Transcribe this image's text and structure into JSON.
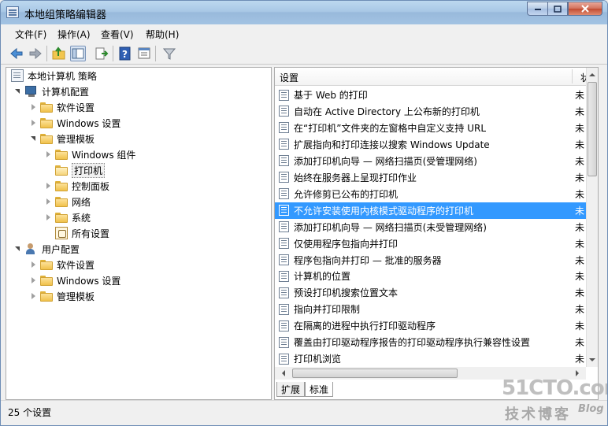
{
  "window": {
    "title": "本地组策略编辑器"
  },
  "menu": [
    "文件(F)",
    "操作(A)",
    "查看(V)",
    "帮助(H)"
  ],
  "toolbar": {
    "icons": [
      "back-icon",
      "forward-icon",
      "up-folder-icon",
      "show-hide-tree-icon",
      "export-list-icon",
      "help-icon",
      "properties-icon",
      "filter-icon"
    ]
  },
  "tree": {
    "root": "本地计算机 策略",
    "computer_config": "计算机配置",
    "cc_software": "软件设置",
    "cc_windows": "Windows 设置",
    "cc_admin": "管理模板",
    "cc_admin_windows_components": "Windows 组件",
    "cc_admin_printers": "打印机",
    "cc_admin_control_panel": "控制面板",
    "cc_admin_network": "网络",
    "cc_admin_system": "系统",
    "cc_admin_all_settings": "所有设置",
    "user_config": "用户配置",
    "uc_software": "软件设置",
    "uc_windows": "Windows 设置",
    "uc_admin": "管理模板"
  },
  "list": {
    "header_setting": "设置",
    "header_state": "状",
    "rows": [
      {
        "text": "基于 Web 的打印",
        "state": "未"
      },
      {
        "text": "自动在 Active Directory 上公布新的打印机",
        "state": "未"
      },
      {
        "text": "在“打印机”文件夹的左窗格中自定义支持 URL",
        "state": "未"
      },
      {
        "text": "扩展指向和打印连接以搜索 Windows Update",
        "state": "未"
      },
      {
        "text": "添加打印机向导 — 网络扫描页(受管理网络)",
        "state": "未"
      },
      {
        "text": "始终在服务器上呈现打印作业",
        "state": "未"
      },
      {
        "text": "允许修剪已公布的打印机",
        "state": "未"
      },
      {
        "text": "不允许安装使用内核模式驱动程序的打印机",
        "state": "未",
        "selected": true
      },
      {
        "text": "添加打印机向导 — 网络扫描页(未受管理网络)",
        "state": "未"
      },
      {
        "text": "仅使用程序包指向并打印",
        "state": "未"
      },
      {
        "text": "程序包指向并打印 — 批准的服务器",
        "state": "未"
      },
      {
        "text": "计算机的位置",
        "state": "未"
      },
      {
        "text": "预设打印机搜索位置文本",
        "state": "未"
      },
      {
        "text": "指向并打印限制",
        "state": "未"
      },
      {
        "text": "在隔离的进程中执行打印驱动程序",
        "state": "未"
      },
      {
        "text": "覆盖由打印驱动程序报告的打印驱动程序执行兼容性设置",
        "state": "未"
      },
      {
        "text": "打印机浏览",
        "state": "未"
      }
    ]
  },
  "tabs": [
    "扩展",
    "标准"
  ],
  "status": "25 个设置",
  "watermark": {
    "line1": "51CTO.com",
    "line2": "技术博客",
    "line3": "Blog"
  }
}
